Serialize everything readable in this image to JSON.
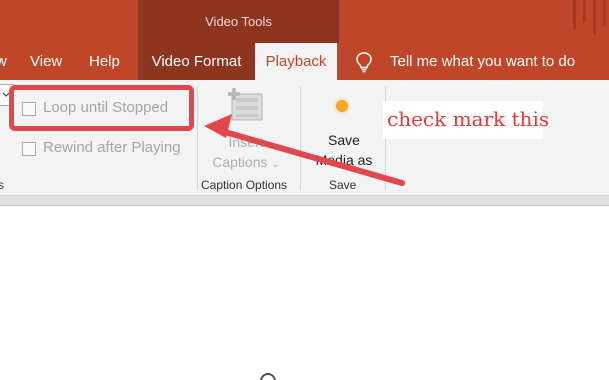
{
  "titlebar": {
    "context_tab_group": "Video Tools"
  },
  "tabs": [
    {
      "label": "w"
    },
    {
      "label": "View"
    },
    {
      "label": "Help"
    },
    {
      "label": "Video Format"
    },
    {
      "label": "Playback"
    },
    {
      "label": "Tell me what you want to do"
    }
  ],
  "ribbon": {
    "loop_label": "Loop until Stopped",
    "rewind_label": "Rewind after Playing",
    "left_group_label_fragment": "s",
    "insert_captions_line1": "Insert",
    "insert_captions_line2": "Captions",
    "caption_group_label": "Caption Options",
    "save_media_line1": "Save",
    "save_media_line2": "Media as",
    "save_group_label": "Save"
  },
  "annotation": {
    "text": "check mark this",
    "color": "#e03a3a"
  },
  "colors": {
    "accent": "#c0462a",
    "context_tab": "#8e3520",
    "ribbon_bg": "#f3f3f3"
  }
}
